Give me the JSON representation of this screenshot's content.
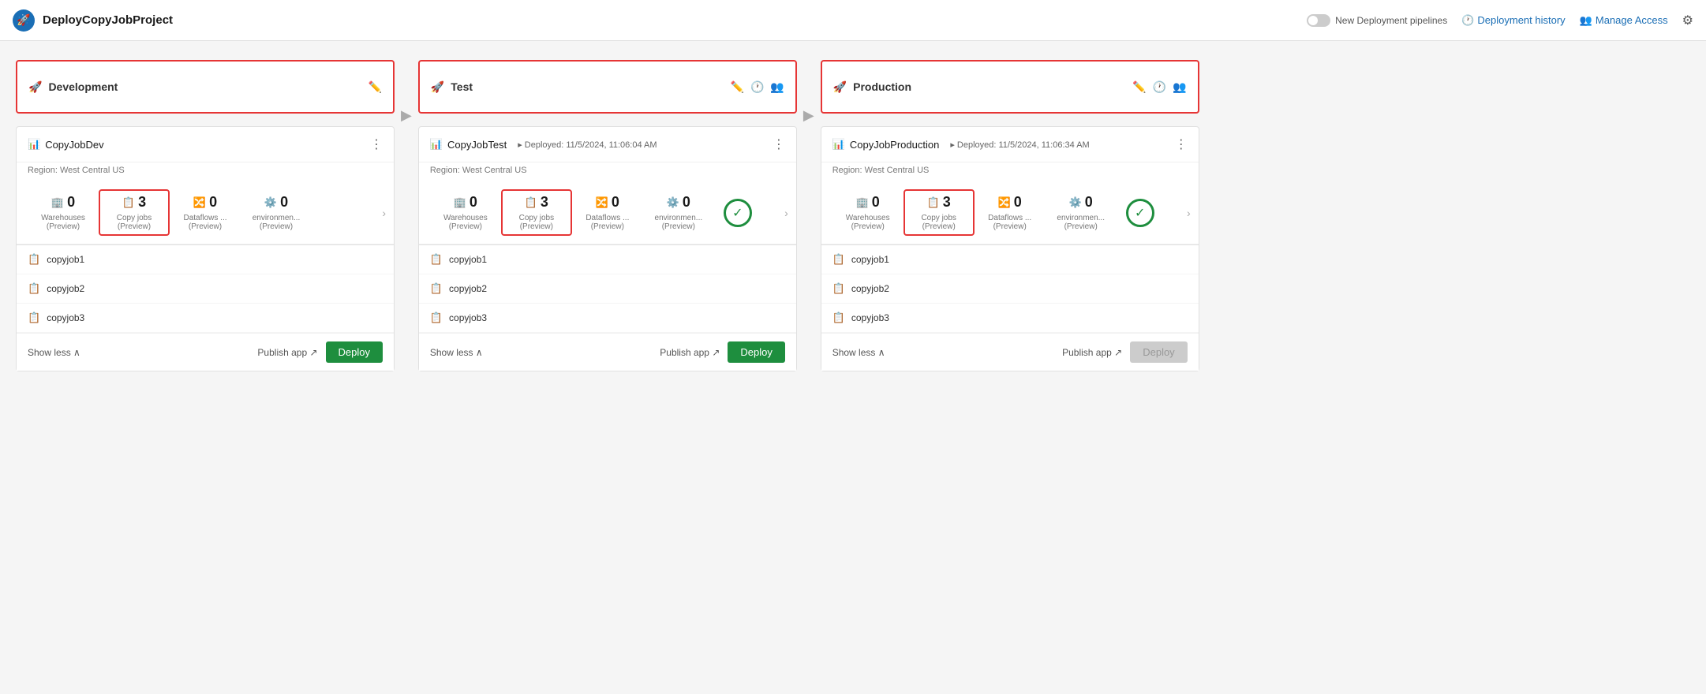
{
  "app": {
    "icon": "🚀",
    "title": "DeployCopyJobProject"
  },
  "topbar": {
    "toggle_label": "New Deployment pipelines",
    "history_label": "Deployment history",
    "access_label": "Manage Access"
  },
  "stages": [
    {
      "id": "development",
      "name": "Development",
      "highlighted": true,
      "show_edit": true,
      "show_history": false,
      "show_users": false,
      "workspace": {
        "name": "CopyJobDev",
        "deployed_info": "",
        "region": "Region: West Central US",
        "metrics": [
          {
            "icon": "🏢",
            "count": 0,
            "label": "Warehouses\n(Preview)",
            "highlighted": false
          },
          {
            "icon": "📋",
            "count": 3,
            "label": "Copy jobs\n(Preview)",
            "highlighted": true
          },
          {
            "icon": "🔀",
            "count": 0,
            "label": "Dataflows ...\n(Preview)",
            "highlighted": false
          },
          {
            "icon": "⚙️",
            "count": 0,
            "label": "environmen...\n(Preview)",
            "highlighted": false
          }
        ],
        "show_success": false,
        "items": [
          "copyjob1",
          "copyjob2",
          "copyjob3"
        ],
        "deploy_disabled": false
      }
    },
    {
      "id": "test",
      "name": "Test",
      "highlighted": true,
      "show_edit": true,
      "show_history": true,
      "show_users": true,
      "workspace": {
        "name": "CopyJobTest",
        "deployed_info": "Deployed: 11/5/2024, 11:06:04 AM",
        "region": "Region: West Central US",
        "metrics": [
          {
            "icon": "🏢",
            "count": 0,
            "label": "Warehouses\n(Preview)",
            "highlighted": false
          },
          {
            "icon": "📋",
            "count": 3,
            "label": "Copy jobs\n(Preview)",
            "highlighted": true
          },
          {
            "icon": "🔀",
            "count": 0,
            "label": "Dataflows ...\n(Preview)",
            "highlighted": false
          },
          {
            "icon": "⚙️",
            "count": 0,
            "label": "environmen...\n(Preview)",
            "highlighted": false
          }
        ],
        "show_success": true,
        "items": [
          "copyjob1",
          "copyjob2",
          "copyjob3"
        ],
        "deploy_disabled": false
      }
    },
    {
      "id": "production",
      "name": "Production",
      "highlighted": true,
      "show_edit": true,
      "show_history": true,
      "show_users": true,
      "workspace": {
        "name": "CopyJobProduction",
        "deployed_info": "Deployed: 11/5/2024, 11:06:34 AM",
        "region": "Region: West Central US",
        "metrics": [
          {
            "icon": "🏢",
            "count": 0,
            "label": "Warehouses\n(Preview)",
            "highlighted": false
          },
          {
            "icon": "📋",
            "count": 3,
            "label": "Copy jobs\n(Preview)",
            "highlighted": true
          },
          {
            "icon": "🔀",
            "count": 0,
            "label": "Dataflows ...\n(Preview)",
            "highlighted": false
          },
          {
            "icon": "⚙️",
            "count": 0,
            "label": "environmen...\n(Preview)",
            "highlighted": false
          }
        ],
        "show_success": true,
        "items": [
          "copyjob1",
          "copyjob2",
          "copyjob3"
        ],
        "deploy_disabled": true
      }
    }
  ],
  "labels": {
    "show_less": "Show less",
    "publish_app": "Publish app",
    "deploy": "Deploy"
  }
}
